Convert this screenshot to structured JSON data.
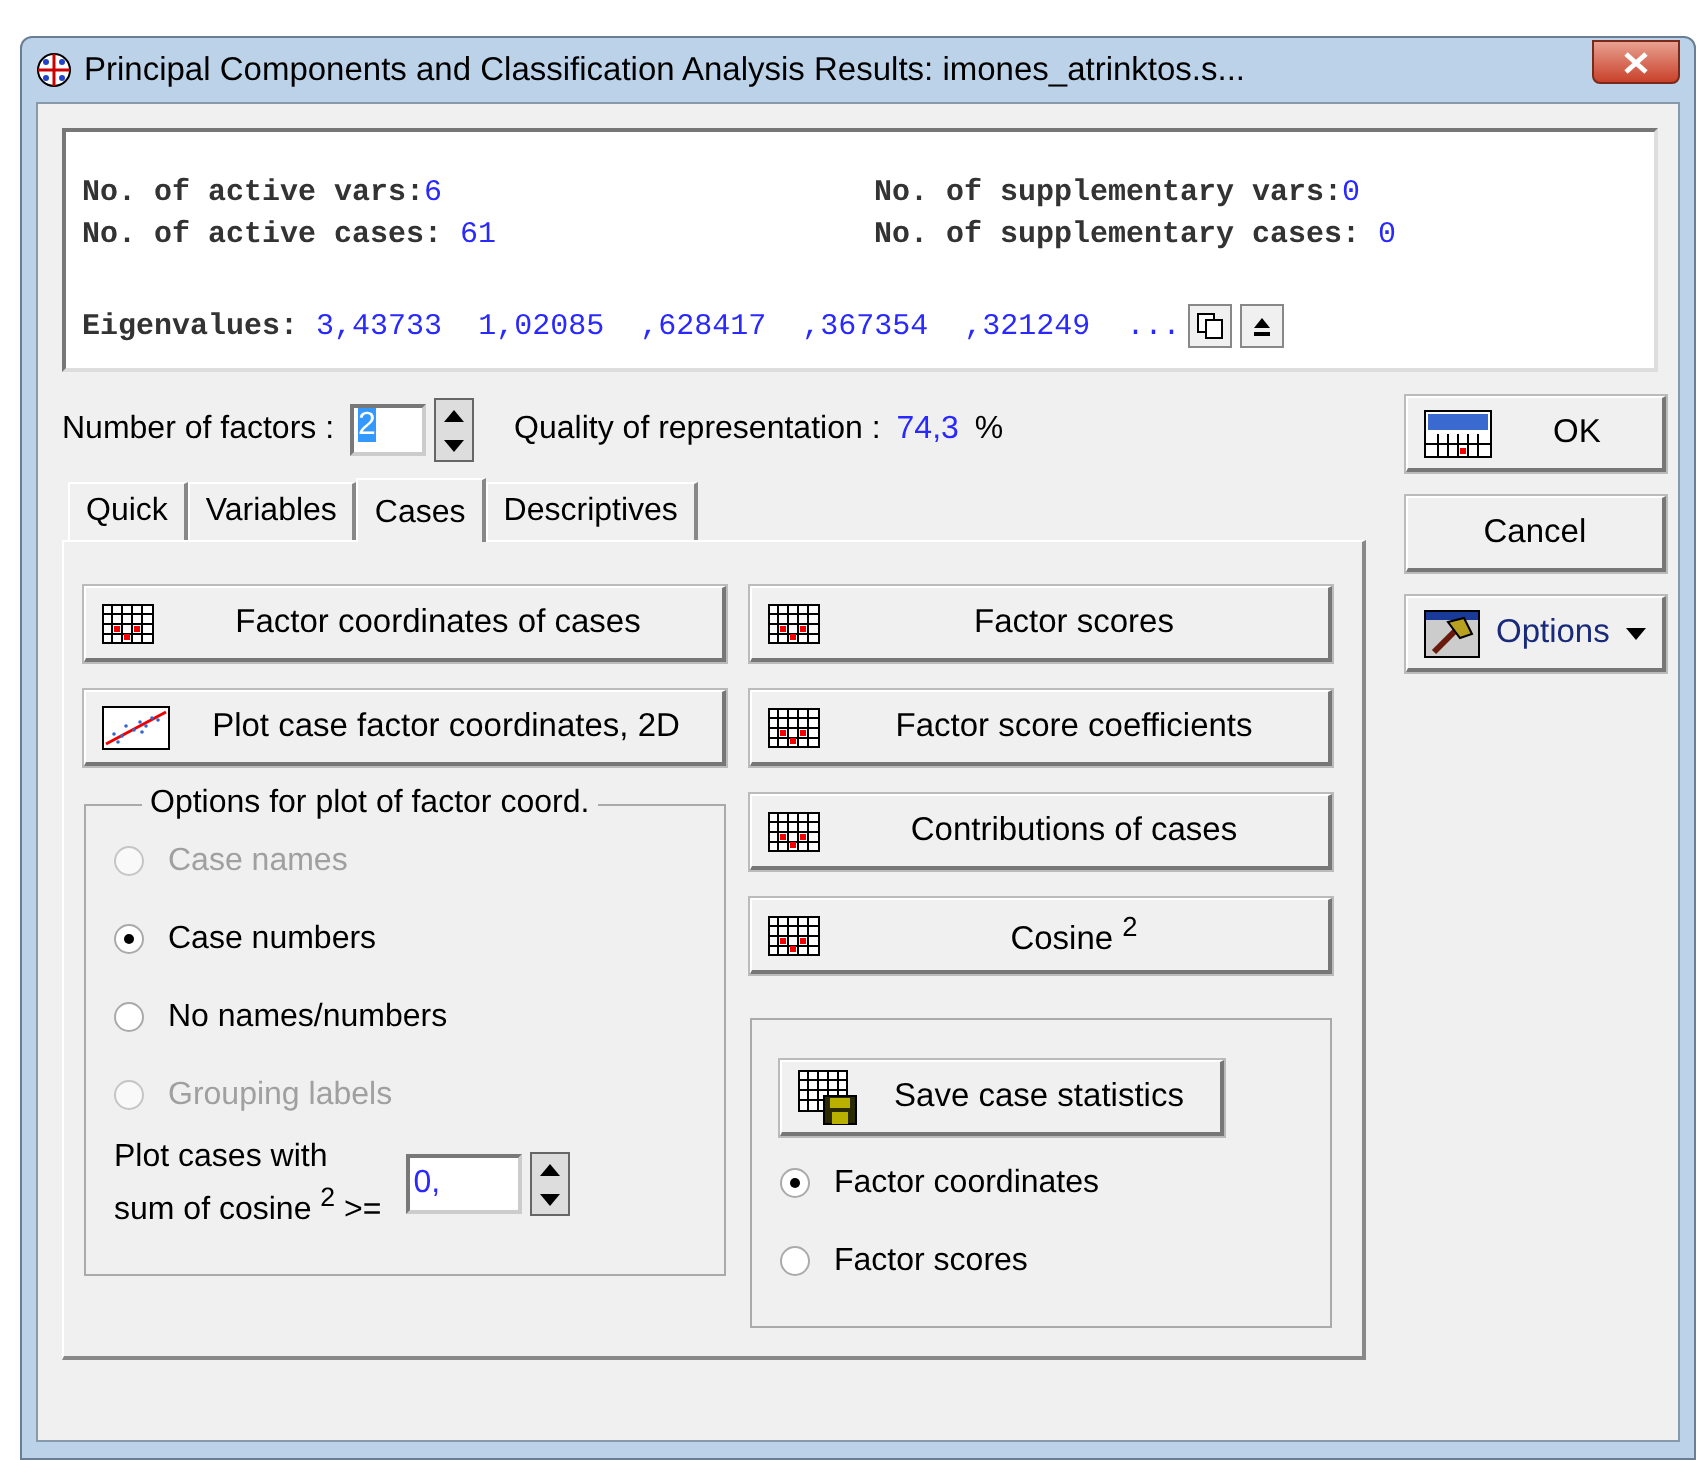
{
  "window": {
    "title": "Principal Components and Classification Analysis Results: imones_atrinktos.s..."
  },
  "summary": [
    {
      "label": "No. of active vars:",
      "value": "6"
    },
    {
      "label": "No. of supplementary vars:",
      "value": "0"
    },
    {
      "label": "No. of active cases: ",
      "value": "61"
    },
    {
      "label": "No. of supplementary cases: ",
      "value": "0"
    }
  ],
  "eigenvalues": {
    "label": "Eigenvalues: ",
    "values": [
      "3,43733",
      "1,02085",
      ",628417",
      ",367354",
      ",321249",
      "..."
    ]
  },
  "factors": {
    "label": "Number of factors :",
    "value": "2"
  },
  "quality": {
    "label": "Quality of representation :",
    "value": "74,3",
    "unit": "%"
  },
  "tabs": [
    {
      "label": "Quick",
      "selected": false
    },
    {
      "label": "Variables",
      "selected": false
    },
    {
      "label": "Cases",
      "selected": true
    },
    {
      "label": "Descriptives",
      "selected": false
    }
  ],
  "left_buttons": [
    {
      "label": "Factor coordinates of cases",
      "kind": "table"
    },
    {
      "label": "Plot case factor coordinates, 2D",
      "kind": "plot"
    }
  ],
  "right_buttons": [
    {
      "label": "Factor scores",
      "kind": "table"
    },
    {
      "label": "Factor score coefficients",
      "kind": "table"
    },
    {
      "label": "Contributions of cases",
      "kind": "table"
    },
    {
      "label": "Cosine $^{2}$",
      "kind": "table"
    }
  ],
  "plot_options": {
    "title": "Options for plot of factor coord.",
    "options": [
      {
        "label": "Case names",
        "selected": false,
        "disabled": true
      },
      {
        "label": "Case numbers",
        "selected": true,
        "disabled": false
      },
      {
        "label": "No names/numbers",
        "selected": false,
        "disabled": false
      },
      {
        "label": "Grouping labels",
        "selected": false,
        "disabled": true
      }
    ],
    "threshold": {
      "line1": "Plot cases with",
      "line2": "sum of cosine $^{2}$ >=",
      "value": "0,"
    }
  },
  "save": {
    "button": "Save case statistics",
    "options": [
      {
        "label": "Factor coordinates",
        "selected": true
      },
      {
        "label": "Factor scores",
        "selected": false
      }
    ]
  },
  "side_buttons": [
    {
      "label": "OK",
      "kind": "summary"
    },
    {
      "label": "Cancel",
      "kind": "plain"
    },
    {
      "label": "Options",
      "kind": "menu"
    }
  ]
}
